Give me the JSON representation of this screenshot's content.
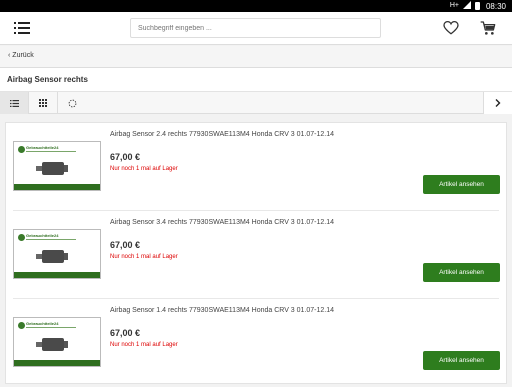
{
  "status_bar": {
    "network": "H+",
    "time": "08:30"
  },
  "header": {
    "search_placeholder": "Suchbegriff eingeben ..."
  },
  "nav": {
    "back_label": "Zurück"
  },
  "page": {
    "title": "Airbag Sensor rechts"
  },
  "colors": {
    "accent_green": "#2e7d1e",
    "stock_red": "#dd0000"
  },
  "products": [
    {
      "name": "Airbag Sensor 2.4 rechts 77930SWAE113M4 Honda CRV 3 01.07-12.14",
      "price": "67,00 €",
      "stock": "Nur noch 1 mal auf Lager",
      "button": "Artikel ansehen",
      "thumb_brand": "Gebrauchtteile24"
    },
    {
      "name": "Airbag Sensor 3.4 rechts 77930SWAE113M4 Honda CRV 3 01.07-12.14",
      "price": "67,00 €",
      "stock": "Nur noch 1 mal auf Lager",
      "button": "Artikel ansehen",
      "thumb_brand": "Gebrauchtteile24"
    },
    {
      "name": "Airbag Sensor 1.4 rechts 77930SWAE113M4 Honda CRV 3 01.07-12.14",
      "price": "67,00 €",
      "stock": "Nur noch 1 mal auf Lager",
      "button": "Artikel ansehen",
      "thumb_brand": "Gebrauchtteile24"
    }
  ]
}
